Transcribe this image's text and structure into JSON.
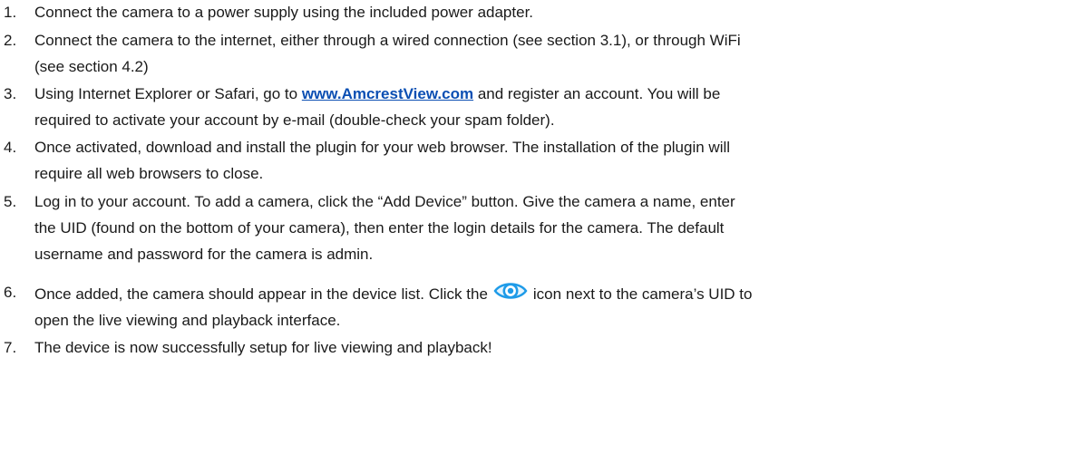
{
  "steps": [
    {
      "number": "1.",
      "lines": [
        "Connect the camera to a power supply using the included power adapter."
      ]
    },
    {
      "number": "2.",
      "lines": [
        "Connect the camera to the internet, either through a wired connection (see section 3.1), or through WiFi",
        "(see section 4.2)"
      ]
    },
    {
      "number": "3.",
      "line1_pre": "Using Internet Explorer or Safari, go to ",
      "link": "www.AmcrestView.com",
      "line1_post": " and register an account. You will be",
      "line2": "required to activate your account by e-mail (double-check your spam folder)."
    },
    {
      "number": "4.",
      "lines": [
        "Once activated, download and install the plugin for your web browser. The installation of the plugin will",
        "require all web browsers to close."
      ]
    },
    {
      "number": "5.",
      "lines": [
        "Log in to your account. To add a camera, click the “Add Device” button. Give the camera a name, enter",
        "the UID (found on the bottom of your camera), then enter the login details for the camera. The default",
        "username and password for the camera is admin."
      ]
    },
    {
      "number": "6.",
      "line1_pre": "Once added, the camera should appear in the device list. Click the",
      "icon": "eye-icon",
      "line1_post": "icon next to the camera’s UID to",
      "line2": "open the live viewing and playback interface."
    },
    {
      "number": "7.",
      "lines": [
        "The device is now successfully setup for live viewing and playback!"
      ]
    }
  ],
  "colors": {
    "link": "#0b4fb3",
    "icon": "#1e9be8"
  }
}
